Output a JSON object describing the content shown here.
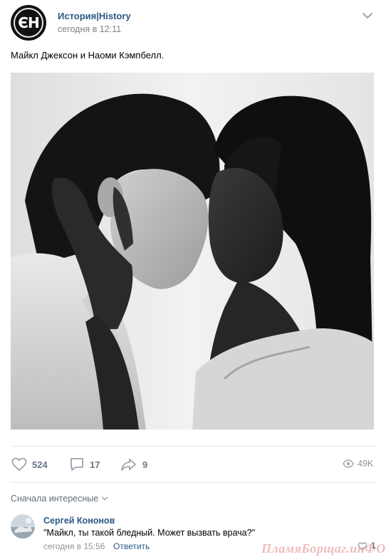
{
  "post": {
    "author": "История|History",
    "time": "сегодня в 12:11",
    "avatar_text": "ЄН",
    "text": "Майкл Джексон и Наоми Кэмпбелл.",
    "photo_alt": "Майкл Джексон и Наоми Кэмпбелл"
  },
  "actions": {
    "likes": "524",
    "comments": "17",
    "shares": "9",
    "views": "49K"
  },
  "comments_section": {
    "sort_label": "Сначала интересные",
    "items": [
      {
        "author": "Сергей Кононов",
        "text": "\"Майкл, ты такой бледный. Может вызвать врача?\"",
        "time": "сегодня в 15:56",
        "reply_label": "Ответить",
        "likes": "1"
      }
    ]
  },
  "watermark": "ПламяБорщаг.инФО",
  "colors": {
    "link": "#2a5885",
    "muted": "#828282",
    "icon": "#99a2ad"
  }
}
